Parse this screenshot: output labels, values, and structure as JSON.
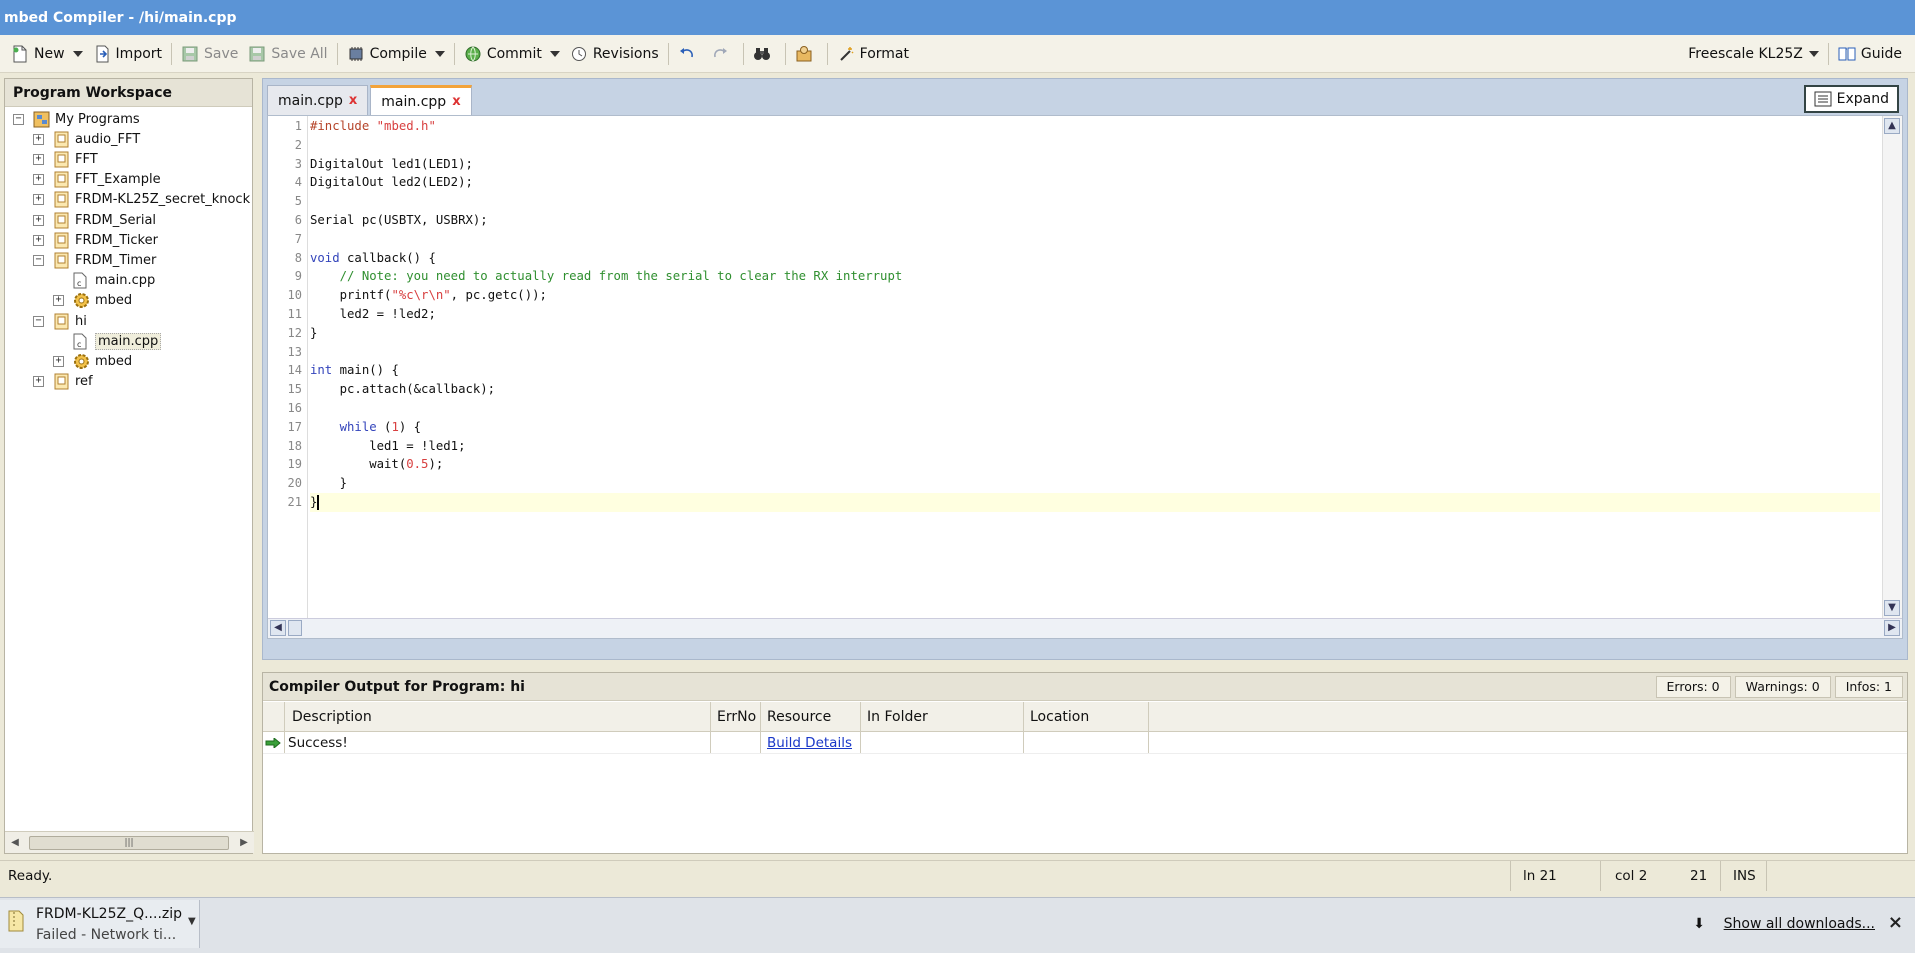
{
  "window": {
    "title": "mbed Compiler - /hi/main.cpp"
  },
  "toolbar": {
    "new_label": "New",
    "import_label": "Import",
    "save_label": "Save",
    "save_all_label": "Save All",
    "compile_label": "Compile",
    "commit_label": "Commit",
    "revisions_label": "Revisions",
    "format_label": "Format",
    "platform_label": "Freescale KL25Z",
    "guide_label": "Guide"
  },
  "workspace": {
    "title": "Program Workspace",
    "tree": [
      {
        "label": "My Programs",
        "icon": "programs-icon",
        "expander": "−",
        "depth": 0
      },
      {
        "label": "audio_FFT",
        "icon": "program-icon",
        "expander": "+",
        "depth": 1
      },
      {
        "label": "FFT",
        "icon": "program-icon",
        "expander": "+",
        "depth": 1
      },
      {
        "label": "FFT_Example",
        "icon": "program-icon",
        "expander": "+",
        "depth": 1
      },
      {
        "label": "FRDM-KL25Z_secret_knock",
        "icon": "program-icon",
        "expander": "+",
        "depth": 1
      },
      {
        "label": "FRDM_Serial",
        "icon": "program-icon",
        "expander": "+",
        "depth": 1
      },
      {
        "label": "FRDM_Ticker",
        "icon": "program-icon",
        "expander": "+",
        "depth": 1
      },
      {
        "label": "FRDM_Timer",
        "icon": "program-icon",
        "expander": "−",
        "depth": 1
      },
      {
        "label": "main.cpp",
        "icon": "cpp-file-icon",
        "expander": "",
        "depth": 2
      },
      {
        "label": "mbed",
        "icon": "library-gear-icon",
        "expander": "+",
        "depth": 2
      },
      {
        "label": "hi",
        "icon": "program-icon",
        "expander": "−",
        "depth": 1
      },
      {
        "label": "main.cpp",
        "icon": "cpp-file-icon",
        "expander": "",
        "depth": 2,
        "selected": true
      },
      {
        "label": "mbed",
        "icon": "library-gear-icon",
        "expander": "+",
        "depth": 2
      },
      {
        "label": "ref",
        "icon": "program-icon",
        "expander": "+",
        "depth": 1
      }
    ]
  },
  "editor": {
    "tabs": [
      {
        "label": "main.cpp",
        "close": "x",
        "active": false
      },
      {
        "label": "main.cpp",
        "close": "x",
        "active": true
      }
    ],
    "expand_label": "Expand",
    "current_line": 21,
    "lines": [
      [
        {
          "t": "#include ",
          "c": "pp"
        },
        {
          "t": "\"mbed.h\"",
          "c": "str"
        }
      ],
      [],
      [
        {
          "t": "DigitalOut led1(LED1);",
          "c": ""
        }
      ],
      [
        {
          "t": "DigitalOut led2(LED2);",
          "c": ""
        }
      ],
      [],
      [
        {
          "t": "Serial pc(USBTX, USBRX);",
          "c": ""
        }
      ],
      [],
      [
        {
          "t": "void",
          "c": "kw"
        },
        {
          "t": " callback() {",
          "c": ""
        }
      ],
      [
        {
          "t": "    // Note: you need to actually read from the serial to clear the RX interrupt",
          "c": "cm"
        }
      ],
      [
        {
          "t": "    printf(",
          "c": ""
        },
        {
          "t": "\"%c\\r\\n\"",
          "c": "str"
        },
        {
          "t": ", pc.getc());",
          "c": ""
        }
      ],
      [
        {
          "t": "    led2 = !led2;",
          "c": ""
        }
      ],
      [
        {
          "t": "}",
          "c": ""
        }
      ],
      [],
      [
        {
          "t": "int",
          "c": "kw"
        },
        {
          "t": " main() {",
          "c": ""
        }
      ],
      [
        {
          "t": "    pc.attach(&callback);",
          "c": ""
        }
      ],
      [],
      [
        {
          "t": "    ",
          "c": ""
        },
        {
          "t": "while",
          "c": "kw"
        },
        {
          "t": " (",
          "c": ""
        },
        {
          "t": "1",
          "c": "num"
        },
        {
          "t": ") {",
          "c": ""
        }
      ],
      [
        {
          "t": "        led1 = !led1;",
          "c": ""
        }
      ],
      [
        {
          "t": "        wait(",
          "c": ""
        },
        {
          "t": "0.5",
          "c": "num"
        },
        {
          "t": ");",
          "c": ""
        }
      ],
      [
        {
          "t": "    }",
          "c": ""
        }
      ],
      [
        {
          "t": "}",
          "c": ""
        }
      ]
    ]
  },
  "output": {
    "title": "Compiler Output for Program: hi",
    "errors": "Errors: 0",
    "warnings": "Warnings: 0",
    "infos": "Infos: 1",
    "columns": [
      "Description",
      "ErrNo",
      "Resource",
      "In Folder",
      "Location"
    ],
    "rows": [
      {
        "description": "Success!",
        "errno": "",
        "resource": "Build Details",
        "folder": "",
        "location": ""
      }
    ]
  },
  "status": {
    "message": "Ready.",
    "line": "ln 21",
    "col": "col 2",
    "count": "21",
    "mode": "INS"
  },
  "downloads": {
    "file_name": "FRDM-KL25Z_Q....zip",
    "file_status": "Failed - Network ti...",
    "show_all": "Show all downloads...",
    "close": "×"
  },
  "colors": {
    "titlebar": "#5b94d6",
    "tab_accent": "#f3a33a",
    "link": "#1a38c8"
  }
}
